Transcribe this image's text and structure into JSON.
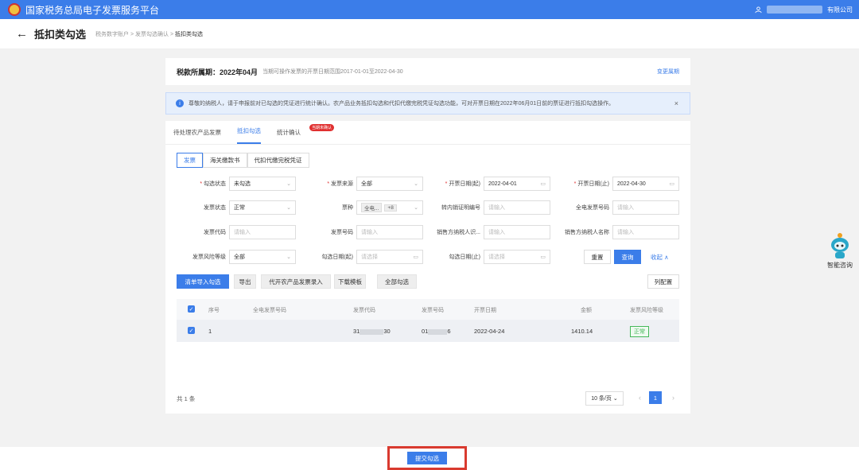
{
  "topbar": {
    "title": "国家税务总局电子发票服务平台",
    "company": "有限公司"
  },
  "header": {
    "back_icon": "arrow-left-icon",
    "title": "抵扣类勾选",
    "breadcrumb": [
      "税务数字账户",
      "发票勾选确认",
      "抵扣类勾选"
    ],
    "separator": ">"
  },
  "period": {
    "label": "税款所属期：",
    "value": "2022年04月",
    "range": "当期可操作发票的开票日期范围2017-01-01至2022-04-30",
    "change": "变更属期"
  },
  "notice": {
    "text": "尊敬的纳税人，请于申报前对已勾选的凭证进行统计确认。农产品业务抵扣勾选和代扣代缴完税凭证勾选功能，可对开票日期在2022年06月01日前的票证进行抵扣勾选操作。",
    "close": "×"
  },
  "tabs": [
    {
      "label": "待处理农产品发票"
    },
    {
      "label": "抵扣勾选"
    },
    {
      "label": "统计确认",
      "badge": "当期未确认"
    }
  ],
  "subtabs": [
    "发票",
    "海关缴款书",
    "代扣代缴完税凭证"
  ],
  "filters": {
    "select_status": {
      "label": "勾选状态",
      "value": "未勾选"
    },
    "invoice_source": {
      "label": "发票来源",
      "value": "全部"
    },
    "issue_date_from": {
      "label": "开票日期(起)",
      "value": "2022-04-01"
    },
    "issue_date_to": {
      "label": "开票日期(止)",
      "value": "2022-04-30"
    },
    "invoice_status": {
      "label": "发票状态",
      "value": "正常"
    },
    "ticket_type": {
      "label": "票种",
      "tag1": "全电...",
      "tag2": "+8"
    },
    "transfer_no": {
      "label": "转内销证明编号",
      "placeholder": "请输入"
    },
    "full_elec_no": {
      "label": "全电发票号码",
      "placeholder": "请输入"
    },
    "invoice_code": {
      "label": "发票代码",
      "placeholder": "请输入"
    },
    "invoice_no": {
      "label": "发票号码",
      "placeholder": "请输入"
    },
    "seller_id": {
      "label": "销售方纳税人识...",
      "placeholder": "请输入"
    },
    "seller_name": {
      "label": "销售方纳税人名称",
      "placeholder": "请输入"
    },
    "risk_level": {
      "label": "发票风险等级",
      "value": "全部"
    },
    "select_date_from": {
      "label": "勾选日期(起)",
      "placeholder": "请选择"
    },
    "select_date_to": {
      "label": "勾选日期(止)",
      "placeholder": "请选择"
    },
    "reset": "重置",
    "query": "查询",
    "collapse": "收起 ∧"
  },
  "actions": [
    "清单导入勾选",
    "导出",
    "代开农产品发票录入",
    "下载模板",
    "全部勾选"
  ],
  "column_config": "列配置",
  "table": {
    "headers": [
      "序号",
      "全电发票号码",
      "发票代码",
      "发票号码",
      "开票日期",
      "金额",
      "发票风险等级"
    ],
    "rows": [
      {
        "index": "1",
        "full_no": "",
        "code_pre": "31",
        "code_suf": "30",
        "no_pre": "01",
        "no_suf": "6",
        "date": "2022-04-24",
        "amount": "1410.14",
        "risk": "正常"
      }
    ]
  },
  "pager": {
    "total": "共 1 条",
    "size": "10 条/页",
    "page": "1",
    "prev": "‹",
    "next": "›"
  },
  "submit": "提交勾选",
  "assistant": {
    "label": "智能咨询"
  }
}
